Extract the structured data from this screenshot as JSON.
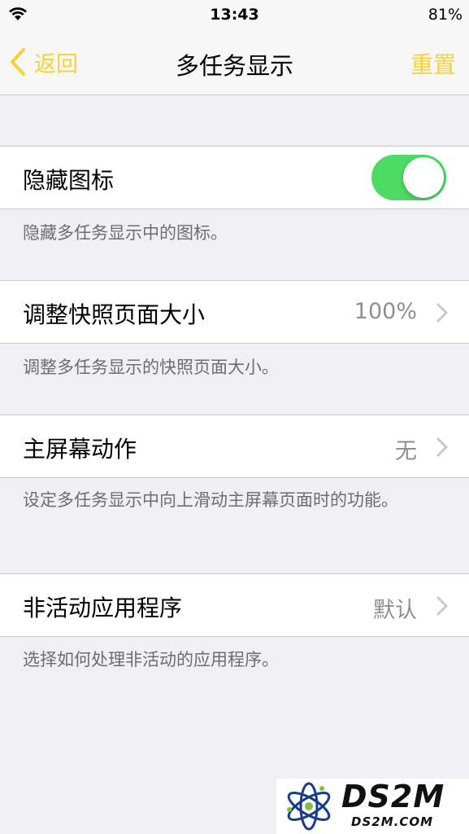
{
  "status_bar": {
    "time": "13:43",
    "battery": "81%",
    "wifi_icon": "wifi-icon"
  },
  "nav": {
    "back_label": "返回",
    "title": "多任务显示",
    "reset_label": "重置",
    "accent_color": "#f7d233"
  },
  "rows": [
    {
      "label": "隐藏图标",
      "toggle_on": true,
      "footnote": "隐藏多任务显示中的图标。"
    },
    {
      "label": "调整快照页面大小",
      "value": "100%",
      "footnote": "调整多任务显示的快照页面大小。"
    },
    {
      "label": "主屏幕动作",
      "value": "无",
      "footnote": "设定多任务显示中向上滑动主屏幕页面时的功能。"
    },
    {
      "label": "非活动应用程序",
      "value": "默认",
      "footnote": "选择如何处理非活动的应用程序。"
    }
  ],
  "watermark": {
    "title": "DS2M",
    "url": "DS2M.COM"
  },
  "colors": {
    "toggle_on": "#4cd964",
    "background": "#efeff4"
  }
}
